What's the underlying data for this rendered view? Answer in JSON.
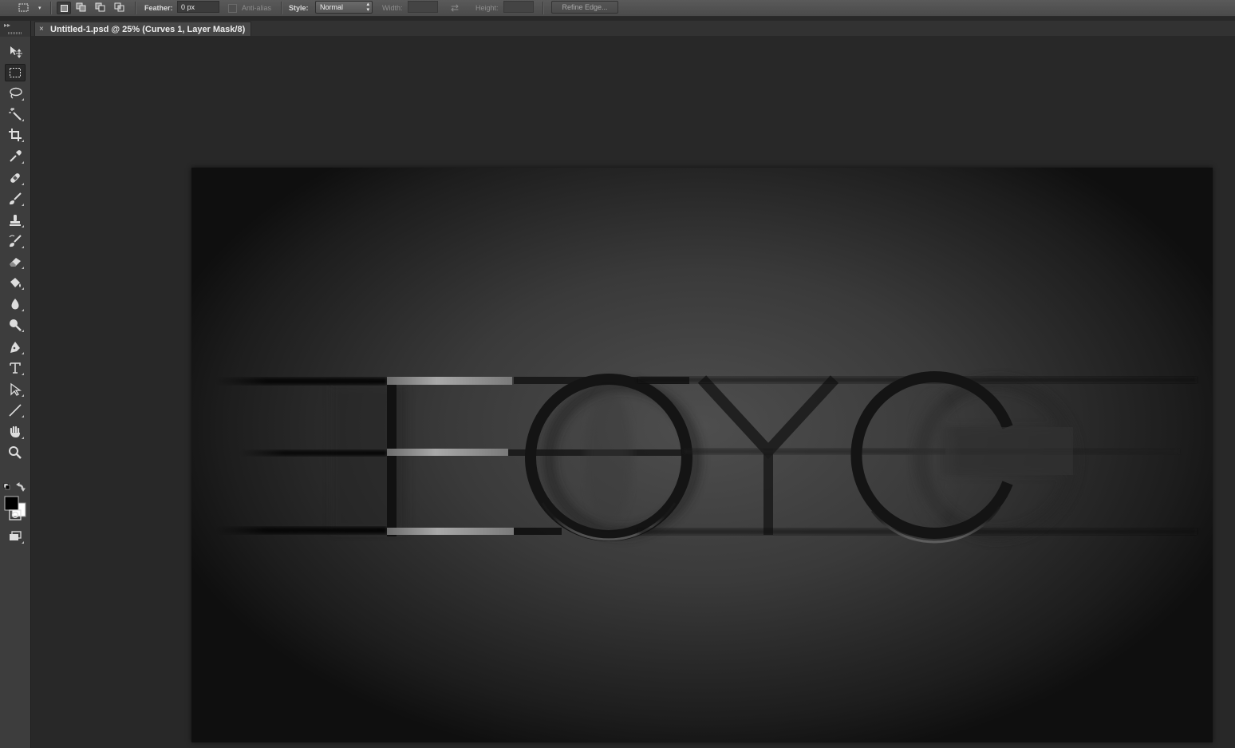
{
  "options_bar": {
    "feather_label": "Feather:",
    "feather_value": "0 px",
    "anti_alias_label": "Anti-alias",
    "style_label": "Style:",
    "style_value": "Normal",
    "width_label": "Width:",
    "height_label": "Height:",
    "refine_edge_label": "Refine Edge..."
  },
  "document": {
    "tab_close": "×",
    "tab_title": "Untitled-1.psd @ 25% (Curves 1, Layer Mask/8)"
  },
  "artwork": {
    "letters": "EOYC"
  },
  "toolbox": {
    "grip": "▸▸",
    "foreground_color": "#000000",
    "background_color": "#ffffff",
    "tools": [
      "move-tool",
      "rectangular-marquee-tool",
      "lasso-tool",
      "magic-wand-tool",
      "crop-tool",
      "eyedropper-tool",
      "healing-brush-tool",
      "brush-tool",
      "clone-stamp-tool",
      "history-brush-tool",
      "eraser-tool",
      "paint-bucket-tool",
      "blur-tool",
      "dodge-tool",
      "pen-tool",
      "type-tool",
      "path-selection-tool",
      "line-tool",
      "hand-tool",
      "zoom-tool"
    ]
  }
}
